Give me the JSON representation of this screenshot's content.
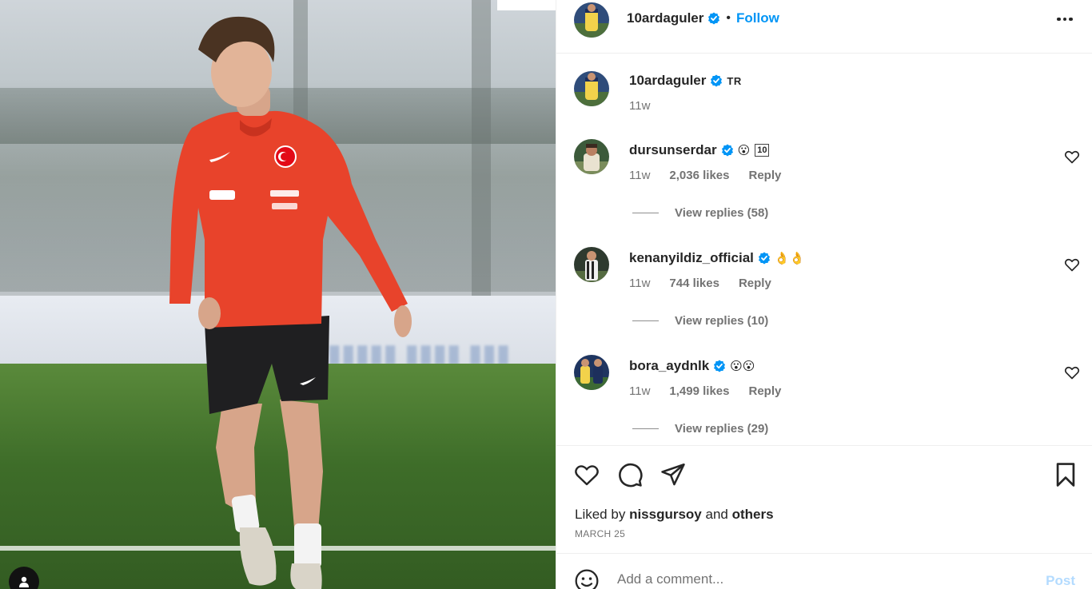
{
  "post": {
    "author": "10ardaguler",
    "follow_label": "Follow",
    "caption_author": "10ardaguler",
    "caption_text": "TR",
    "caption_time": "11w",
    "liked_by_prefix": "Liked by",
    "liked_by_user": "nissgursoy",
    "liked_by_and": "and",
    "liked_by_others": "others",
    "date": "MARCH 25"
  },
  "comments": [
    {
      "user": "dursunserdar",
      "time": "11w",
      "likes": "2,036 likes",
      "reply": "Reply",
      "view_replies": "View replies (58)",
      "emoji": "😮",
      "badge": "10"
    },
    {
      "user": "kenanyildiz_official",
      "time": "11w",
      "likes": "744 likes",
      "reply": "Reply",
      "view_replies": "View replies (10)",
      "emoji": "👌👌"
    },
    {
      "user": "bora_aydnlk",
      "time": "11w",
      "likes": "1,499 likes",
      "reply": "Reply",
      "view_replies": "View replies (29)",
      "emoji": "😮😮"
    }
  ],
  "composer": {
    "placeholder": "Add a comment...",
    "post_label": "Post"
  },
  "colors": {
    "accent": "#0095f6",
    "verified": "#0095f6",
    "jersey": "#e8432b"
  },
  "icons": [
    "verified-icon",
    "more-options-icon",
    "heart-icon",
    "comment-icon",
    "share-icon",
    "save-icon",
    "emoji-icon",
    "user-icon"
  ]
}
